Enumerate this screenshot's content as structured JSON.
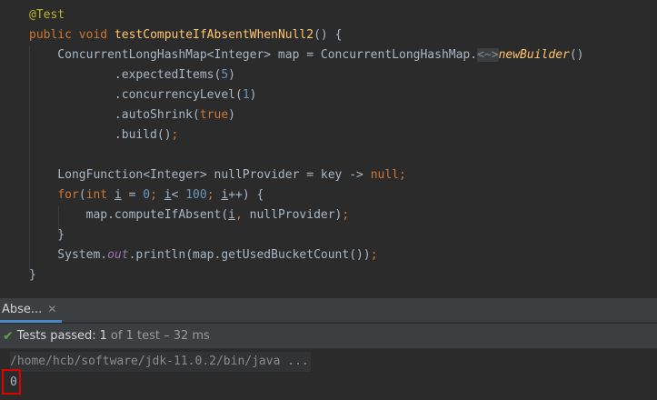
{
  "code_lines": [
    [
      {
        "t": "@Test",
        "c": "ann"
      }
    ],
    [
      {
        "t": "public ",
        "c": "kw"
      },
      {
        "t": "void ",
        "c": "kw"
      },
      {
        "t": "testComputeIfAbsentWhenNull2",
        "c": "fn"
      },
      {
        "t": "() {",
        "c": "plain"
      }
    ],
    [
      {
        "t": "    ConcurrentLongHashMap<Integer> map = ConcurrentLongHashMap.",
        "c": "plain"
      },
      {
        "t": "<~>",
        "c": "fold"
      },
      {
        "t": "newBuilder",
        "c": "static"
      },
      {
        "t": "()",
        "c": "plain"
      }
    ],
    [
      {
        "t": "            .expectedItems(",
        "c": "plain"
      },
      {
        "t": "5",
        "c": "num"
      },
      {
        "t": ")",
        "c": "plain"
      }
    ],
    [
      {
        "t": "            .concurrencyLevel(",
        "c": "plain"
      },
      {
        "t": "1",
        "c": "num"
      },
      {
        "t": ")",
        "c": "plain"
      }
    ],
    [
      {
        "t": "            .autoShrink(",
        "c": "plain"
      },
      {
        "t": "true",
        "c": "kw"
      },
      {
        "t": ")",
        "c": "plain"
      }
    ],
    [
      {
        "t": "            .build()",
        "c": "plain"
      },
      {
        "t": ";",
        "c": "punct"
      }
    ],
    [],
    [
      {
        "t": "    LongFunction<Integer> nullProvider = key -> ",
        "c": "plain"
      },
      {
        "t": "null",
        "c": "kw"
      },
      {
        "t": ";",
        "c": "punct"
      }
    ],
    [
      {
        "t": "    ",
        "c": "plain"
      },
      {
        "t": "for",
        "c": "kw"
      },
      {
        "t": "(",
        "c": "plain"
      },
      {
        "t": "int ",
        "c": "kw"
      },
      {
        "t": "i",
        "c": "var"
      },
      {
        "t": " = ",
        "c": "plain"
      },
      {
        "t": "0",
        "c": "num"
      },
      {
        "t": "; ",
        "c": "punct"
      },
      {
        "t": "i",
        "c": "var"
      },
      {
        "t": "< ",
        "c": "plain"
      },
      {
        "t": "100",
        "c": "num"
      },
      {
        "t": "; ",
        "c": "punct"
      },
      {
        "t": "i",
        "c": "var"
      },
      {
        "t": "++) {",
        "c": "plain"
      }
    ],
    [
      {
        "t": "        map.computeIfAbsent(",
        "c": "plain"
      },
      {
        "t": "i",
        "c": "var"
      },
      {
        "t": ", ",
        "c": "punct"
      },
      {
        "t": "nullProvider)",
        "c": "plain"
      },
      {
        "t": ";",
        "c": "punct"
      }
    ],
    [
      {
        "t": "    }",
        "c": "plain"
      }
    ],
    [
      {
        "t": "    System.",
        "c": "plain"
      },
      {
        "t": "out",
        "c": "field"
      },
      {
        "t": ".println(map.getUsedBucketCount())",
        "c": "plain"
      },
      {
        "t": ";",
        "c": "punct"
      }
    ],
    [
      {
        "t": "}",
        "c": "plain"
      }
    ]
  ],
  "run_panel": {
    "tab_label": "Abse...",
    "close_glyph": "✕",
    "status_icon": "check-icon",
    "status_prefix": "Tests passed:",
    "status_count": "1",
    "status_suffix": "of 1 test – 32 ms",
    "command_line": "/home/hcb/software/jdk-11.0.2/bin/java ...",
    "output_value": "0"
  },
  "colors": {
    "background": "#2b2b2b",
    "keyword": "#cc7832",
    "function": "#ffc66d",
    "number": "#6897bb",
    "annotation": "#bbb529",
    "text": "#a9b7c6",
    "success": "#5f9e4f",
    "highlight": "#e00000"
  }
}
